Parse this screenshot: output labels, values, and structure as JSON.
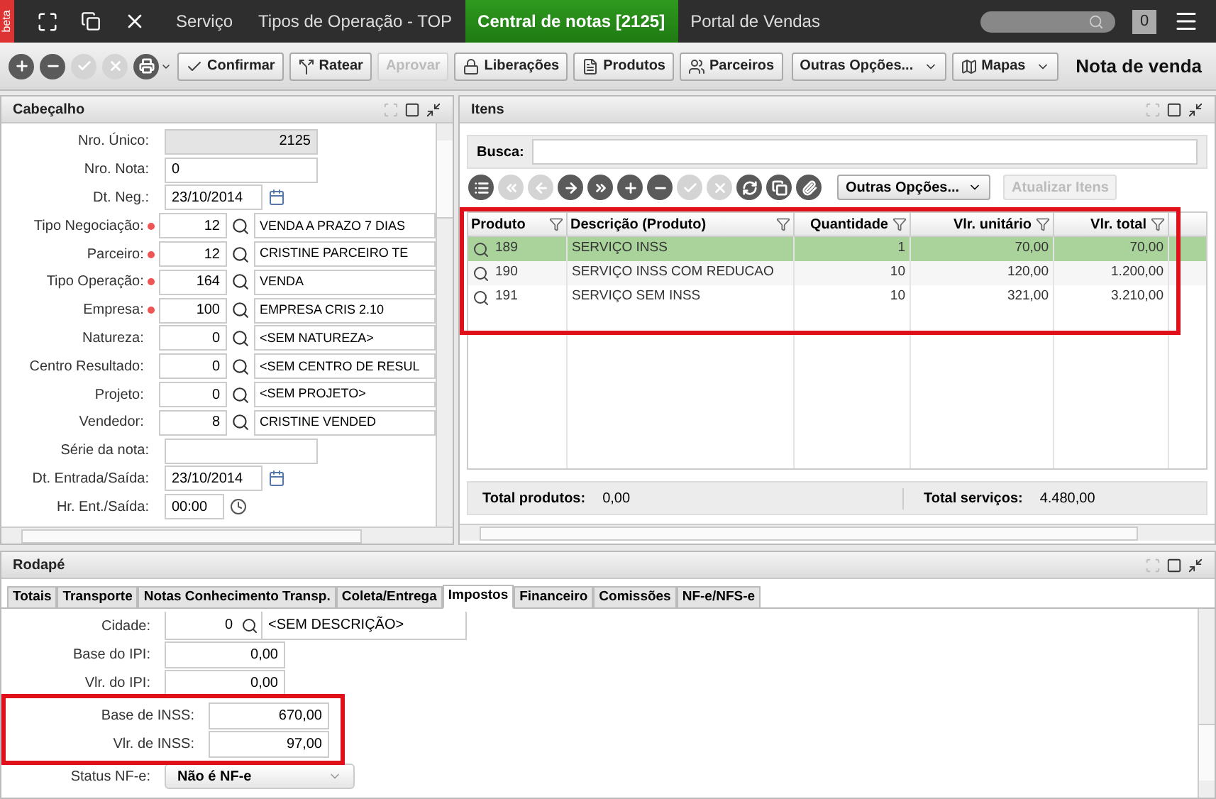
{
  "topbar": {
    "badge": "beta",
    "tabs": [
      {
        "label": "Serviço",
        "selected": false
      },
      {
        "label": "Tipos de Operação - TOP",
        "selected": false
      },
      {
        "label": "Central de notas [2125]",
        "selected": true
      },
      {
        "label": "Portal de Vendas",
        "selected": false
      }
    ],
    "counter": "0"
  },
  "toolbar": {
    "icons": [
      {
        "kind": "add",
        "disabled": false
      },
      {
        "kind": "remove",
        "disabled": false
      },
      {
        "kind": "confirm",
        "disabled": true
      },
      {
        "kind": "cancel",
        "disabled": true
      },
      {
        "kind": "print",
        "disabled": false
      }
    ],
    "buttons": [
      {
        "label": "Confirmar",
        "kind": "confirm",
        "disabled": false
      },
      {
        "label": "Ratear",
        "kind": "split",
        "disabled": false
      },
      {
        "label": "Aprovar",
        "kind": "none",
        "disabled": true
      },
      {
        "label": "Liberações",
        "kind": "lock",
        "disabled": false
      },
      {
        "label": "Produtos",
        "kind": "doc",
        "disabled": false
      },
      {
        "label": "Parceiros",
        "kind": "partner",
        "disabled": false
      },
      {
        "label": "Outras Opções...",
        "kind": "dropdown",
        "disabled": false
      },
      {
        "label": "Mapas",
        "kind": "map",
        "disabled": false
      }
    ],
    "title": "Nota de venda"
  },
  "header_panel": {
    "title": "Cabeçalho",
    "fields": [
      {
        "label": "Nro. Único:",
        "kind": "plain",
        "value": "2125",
        "disabled": true,
        "required": false
      },
      {
        "label": "Nro. Nota:",
        "kind": "plain",
        "value": "0",
        "disabled": false,
        "required": false
      },
      {
        "label": "Dt.  Neg.:",
        "kind": "date",
        "value": "23/10/2014",
        "required": false
      },
      {
        "label": "Tipo Negociação:",
        "kind": "lookup",
        "code": "12",
        "description": "VENDA A PRAZO 7 DIAS",
        "required": true
      },
      {
        "label": "Parceiro:",
        "kind": "lookup",
        "code": "12",
        "description": "CRISTINE PARCEIRO TE",
        "required": true
      },
      {
        "label": "Tipo Operação:",
        "kind": "lookup",
        "code": "164",
        "description": "VENDA",
        "required": true
      },
      {
        "label": "Empresa:",
        "kind": "lookup",
        "code": "100",
        "description": "EMPRESA CRIS 2.10",
        "required": true
      },
      {
        "label": "Natureza:",
        "kind": "lookup",
        "code": "0",
        "description": "<SEM NATUREZA>",
        "required": false
      },
      {
        "label": "Centro Resultado:",
        "kind": "lookup",
        "code": "0",
        "description": "<SEM CENTRO DE RESUL",
        "required": false
      },
      {
        "label": "Projeto:",
        "kind": "lookup",
        "code": "0",
        "description": "<SEM PROJETO>",
        "required": false
      },
      {
        "label": "Vendedor:",
        "kind": "lookup",
        "code": "8",
        "description": "CRISTINE VENDED",
        "required": false
      },
      {
        "label": "Série da nota:",
        "kind": "plain",
        "disabled": false,
        "required": false
      },
      {
        "label": "Dt. Entrada/Saída:",
        "kind": "date",
        "value": "23/10/2014",
        "required": false
      },
      {
        "label": "Hr. Ent./Saída:",
        "kind": "time",
        "value": "00:00",
        "required": false
      }
    ]
  },
  "items_panel": {
    "title": "Itens",
    "search_label": "Busca:",
    "tools": [
      {
        "kind": "menu",
        "disabled": false
      },
      {
        "kind": "first",
        "disabled": true
      },
      {
        "kind": "prev",
        "disabled": true
      },
      {
        "kind": "next",
        "disabled": false
      },
      {
        "kind": "last",
        "disabled": false
      },
      {
        "kind": "add",
        "disabled": false
      },
      {
        "kind": "remove",
        "disabled": false
      },
      {
        "kind": "confirm",
        "disabled": true
      },
      {
        "kind": "cancel",
        "disabled": true
      },
      {
        "kind": "refresh",
        "disabled": false
      },
      {
        "kind": "copy",
        "disabled": false
      },
      {
        "kind": "attach",
        "disabled": false
      }
    ],
    "more_button": "Outras Opções...",
    "update_button": {
      "label": "Atualizar Itens",
      "disabled": true
    },
    "table": {
      "highlighted": true,
      "columns": [
        "Produto",
        "Descrição (Produto)",
        "Quantidade",
        "Vlr. unitário",
        "Vlr. total"
      ],
      "rows": [
        {
          "cells": [
            "189",
            "SERVIÇO INSS",
            "1",
            "70,00",
            "70,00"
          ],
          "selected": true
        },
        {
          "cells": [
            "190",
            "SERVIÇO INSS COM REDUCAO",
            "10",
            "120,00",
            "1.200,00"
          ],
          "selected": false
        },
        {
          "cells": [
            "191",
            "SERVIÇO SEM INSS",
            "10",
            "321,00",
            "3.210,00"
          ],
          "selected": false
        }
      ]
    },
    "totals": [
      {
        "label": "Total produtos:",
        "value": "0,00"
      },
      {
        "label": "Total serviços:",
        "value": "4.480,00"
      }
    ]
  },
  "footer_panel": {
    "title": "Rodapé",
    "tabs": [
      {
        "label": "Totais",
        "selected": false
      },
      {
        "label": "Transporte",
        "selected": false
      },
      {
        "label": "Notas Conhecimento Transp.",
        "selected": false
      },
      {
        "label": "Coleta/Entrega",
        "selected": false
      },
      {
        "label": "Impostos",
        "selected": true
      },
      {
        "label": "Financeiro",
        "selected": false
      },
      {
        "label": "Comissões",
        "selected": false
      },
      {
        "label": "NF-e/NFS-e",
        "selected": false
      }
    ],
    "fields": [
      {
        "label": "Cidade:",
        "kind": "lookup",
        "code": "0",
        "description": "<SEM DESCRIÇÃO>",
        "highlighted": false
      },
      {
        "label": "Base do IPI:",
        "kind": "number",
        "value": "0,00",
        "highlighted": false
      },
      {
        "label": "Vlr. do IPI:",
        "kind": "number",
        "value": "0,00",
        "highlighted": false
      },
      {
        "label": "Base de INSS:",
        "kind": "number",
        "value": "670,00",
        "highlighted": true
      },
      {
        "label": "Vlr. de INSS:",
        "kind": "number",
        "value": "97,00",
        "highlighted": true
      },
      {
        "label": "Status NF-e:",
        "kind": "select",
        "value": "Não é NF-e",
        "highlighted": false
      }
    ]
  }
}
